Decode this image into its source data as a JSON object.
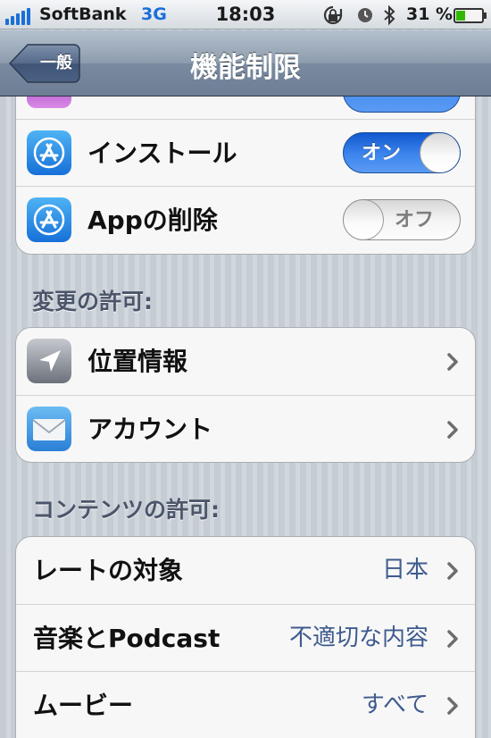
{
  "status_bar": {
    "carrier": "SoftBank",
    "network": "3G",
    "time": "18:03",
    "battery_percent": "31 %"
  },
  "nav": {
    "back_label": "一般",
    "title": "機能制限"
  },
  "allow_group": {
    "items": [
      {
        "label": "インストール",
        "icon": "app-store-icon",
        "switch_state": "オン"
      },
      {
        "label": "Appの削除",
        "icon": "app-store-icon",
        "switch_state": "オフ"
      }
    ]
  },
  "changes_section": {
    "header": "変更の許可:",
    "items": [
      {
        "label": "位置情報",
        "icon": "location-arrow-icon"
      },
      {
        "label": "アカウント",
        "icon": "mail-icon"
      }
    ]
  },
  "content_section": {
    "header": "コンテンツの許可:",
    "items": [
      {
        "label": "レートの対象",
        "value": "日本"
      },
      {
        "label": "音楽とPodcast",
        "value": "不適切な内容"
      },
      {
        "label": "ムービー",
        "value": "すべて"
      }
    ]
  },
  "colors": {
    "switch_on": "#3d86ee",
    "value_text": "#3f5b8e",
    "nav_bar": "#7a8aa0"
  }
}
